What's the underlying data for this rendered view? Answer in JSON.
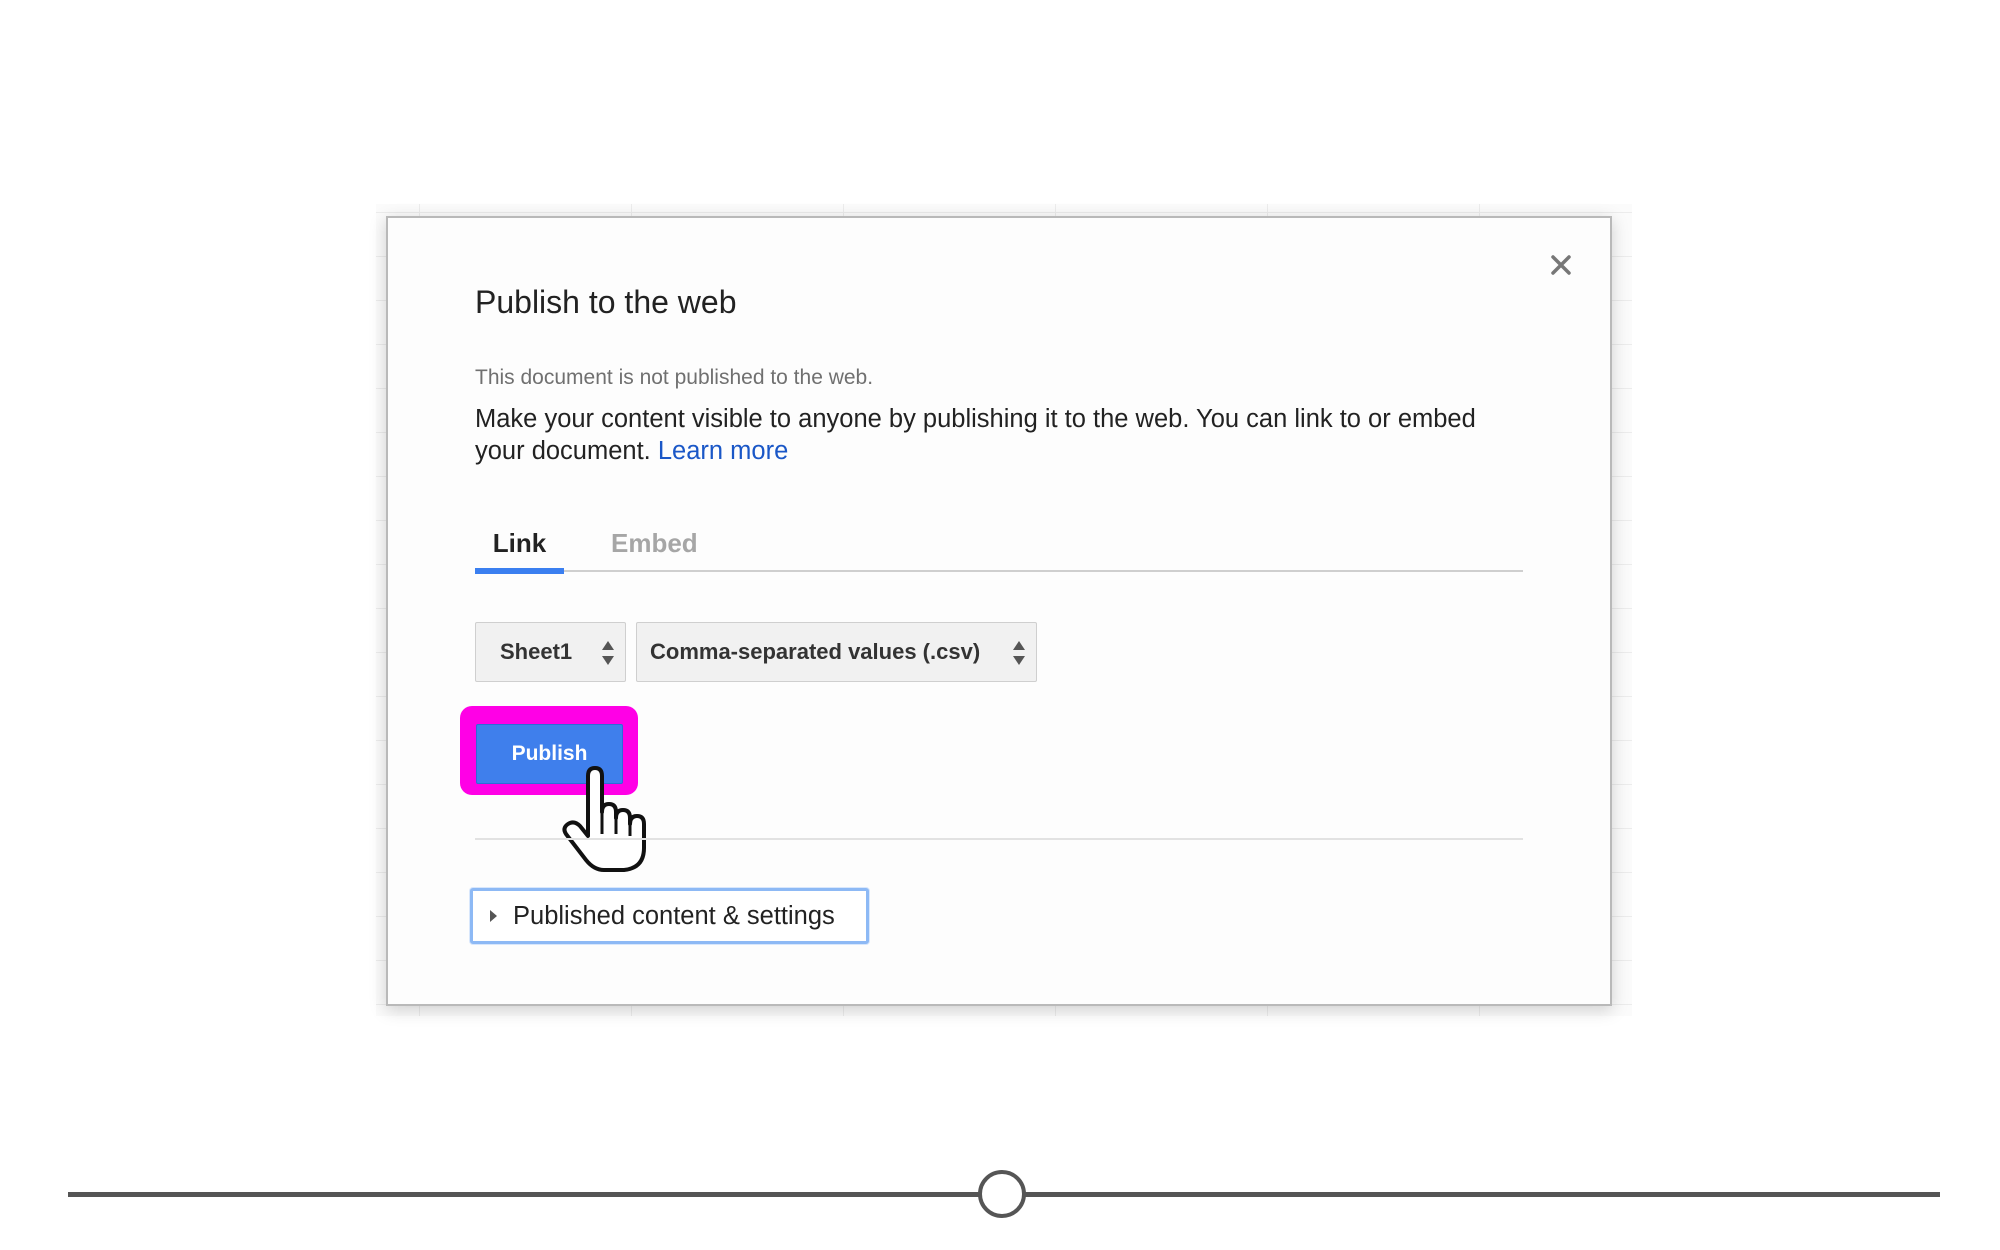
{
  "dialog": {
    "title": "Publish to the web",
    "status": "This document is not published to the web.",
    "description": "Make your content visible to anyone by publishing it to the web. You can link to or embed your document.",
    "learn_more": "Learn more",
    "close_icon": "close-icon"
  },
  "tabs": [
    {
      "label": "Link",
      "active": true
    },
    {
      "label": "Embed",
      "active": false
    }
  ],
  "selects": {
    "sheet": "Sheet1",
    "format": "Comma-separated values (.csv)"
  },
  "publish_button": "Publish",
  "settings_toggle": "Published content & settings",
  "colors": {
    "accent": "#3f7fec",
    "highlight": "#ff00e6",
    "link": "#1a57c7"
  },
  "slider": {
    "position_fraction": 0.5
  }
}
